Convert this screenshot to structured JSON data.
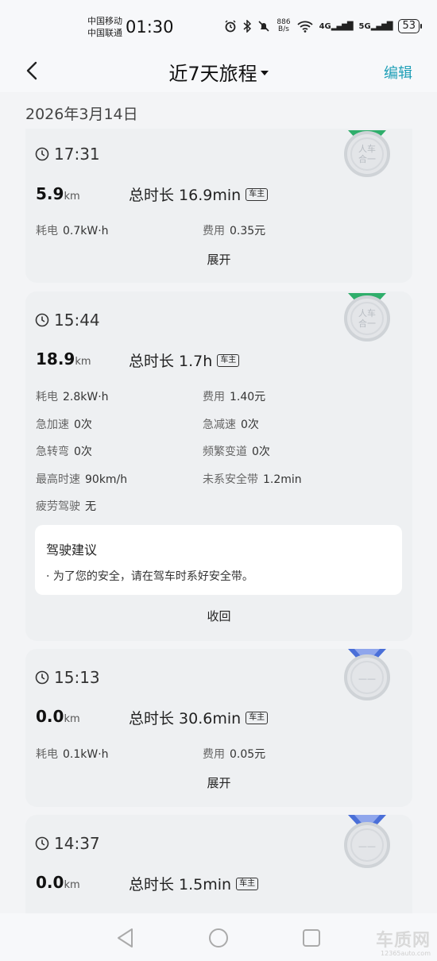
{
  "status_bar": {
    "carrier1": "中国移动",
    "carrier2": "中国联通",
    "time": "01:30",
    "net_speed_value": "886",
    "net_speed_unit": "B/s",
    "signal1": "4G",
    "signal2": "5G",
    "battery": "53"
  },
  "nav": {
    "title": "近7天旅程",
    "edit": "编辑"
  },
  "date": "2026年3月14日",
  "trips": [
    {
      "time": "17:31",
      "distance": "5.9",
      "distance_unit": "km",
      "duration": "总时长 16.9min",
      "badge": "车主",
      "energy_label": "耗电",
      "energy": "0.7kW·h",
      "cost_label": "费用",
      "cost": "0.35元",
      "toggle": "展开",
      "medal": "人车合一",
      "medal_color": "#2fae6b"
    },
    {
      "time": "15:44",
      "distance": "18.9",
      "distance_unit": "km",
      "duration": "总时长 1.7h",
      "badge": "车主",
      "energy_label": "耗电",
      "energy": "2.8kW·h",
      "cost_label": "费用",
      "cost": "1.40元",
      "accel_label": "急加速",
      "accel": "0次",
      "brake_label": "急减速",
      "brake": "0次",
      "turn_label": "急转弯",
      "turn": "0次",
      "lane_label": "频繁变道",
      "lane": "0次",
      "maxspeed_label": "最高时速",
      "maxspeed": "90km/h",
      "belt_label": "未系安全带",
      "belt": "1.2min",
      "fatigue_label": "疲劳驾驶",
      "fatigue": "无",
      "advice_title": "驾驶建议",
      "advice_text": "· 为了您的安全，请在驾车时系好安全带。",
      "toggle": "收回",
      "medal": "人车合一",
      "medal_color": "#2fae6b"
    },
    {
      "time": "15:13",
      "distance": "0.0",
      "distance_unit": "km",
      "duration": "总时长 30.6min",
      "badge": "车主",
      "energy_label": "耗电",
      "energy": "0.1kW·h",
      "cost_label": "费用",
      "cost": "0.05元",
      "toggle": "展开",
      "medal": "——",
      "medal_color": "#4a6fd8"
    },
    {
      "time": "14:37",
      "distance": "0.0",
      "distance_unit": "km",
      "duration": "总时长 1.5min",
      "badge": "车主",
      "medal": "——",
      "medal_color": "#4a6fd8"
    }
  ],
  "watermark": {
    "logo": "车质网",
    "url": "12365auto.com"
  }
}
